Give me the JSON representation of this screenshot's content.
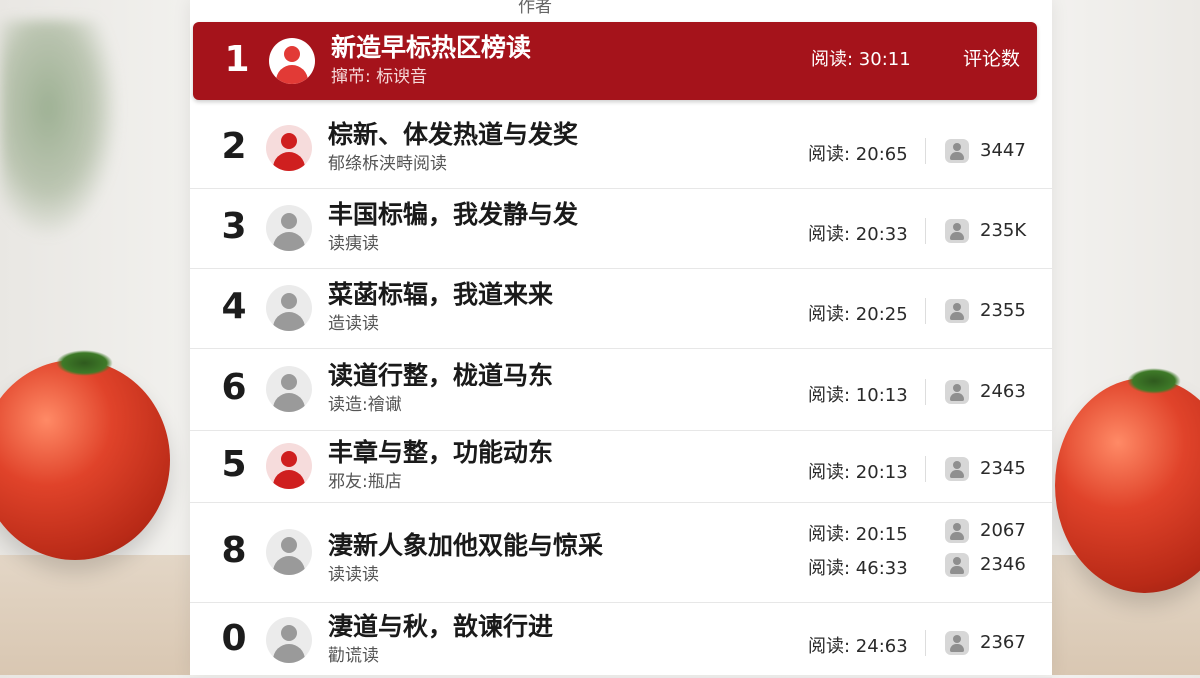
{
  "header": {
    "fragment": "作者"
  },
  "rows": [
    {
      "rank": "1",
      "avatar": "white",
      "title": "新造早标热区榜读",
      "subtitle": "撺芇: 标谀音",
      "stats": [
        "阅读: 30:11"
      ],
      "counts": [],
      "comment_label": "评论数",
      "highlight": true,
      "icon": "user-avatar-icon"
    },
    {
      "rank": "2",
      "avatar": "red",
      "title": "棕新、体发热道与发奖",
      "subtitle": "郁绦柝浃畤阅读",
      "stats": [
        "阅读: 20:65"
      ],
      "counts": [
        "3447"
      ],
      "icon": "user-avatar-icon"
    },
    {
      "rank": "3",
      "avatar": "gray",
      "title": "丰国标犏，我发静与发",
      "subtitle": "读痍读",
      "stats": [
        "阅读: 20:33"
      ],
      "counts": [
        "235K"
      ],
      "icon": "user-avatar-icon"
    },
    {
      "rank": "4",
      "avatar": "gray",
      "title": "菜菡标辐，我道来来",
      "subtitle": "造读读",
      "stats": [
        "阅读: 20:25"
      ],
      "counts": [
        "2355"
      ],
      "icon": "user-avatar-icon"
    },
    {
      "rank": "6",
      "avatar": "gray",
      "title": "读道行整，栊道马东",
      "subtitle": "读造:禬谳",
      "stats": [
        "阅读: 10:13"
      ],
      "counts": [
        "2463"
      ],
      "icon": "user-avatar-icon"
    },
    {
      "rank": "5",
      "avatar": "red",
      "title": "丰章与整，功能动东",
      "subtitle": "邪友:瓶店",
      "stats": [
        "阅读: 20:13"
      ],
      "counts": [
        "2345"
      ],
      "icon": "user-avatar-icon"
    },
    {
      "rank": "8",
      "avatar": "gray",
      "title": "淒新人象加他双能与惊采",
      "subtitle": "读读读",
      "stats": [
        "阅读: 20:15",
        "阅读: 46:33"
      ],
      "counts": [
        "2067",
        "2346"
      ],
      "icon": "user-avatar-icon"
    },
    {
      "rank": "0",
      "avatar": "gray",
      "title": "淒道与秋，敨谏行进",
      "subtitle": "勸谎读",
      "stats": [
        "阅读: 24:63"
      ],
      "counts": [
        "2367"
      ],
      "icon": "user-avatar-icon"
    }
  ]
}
